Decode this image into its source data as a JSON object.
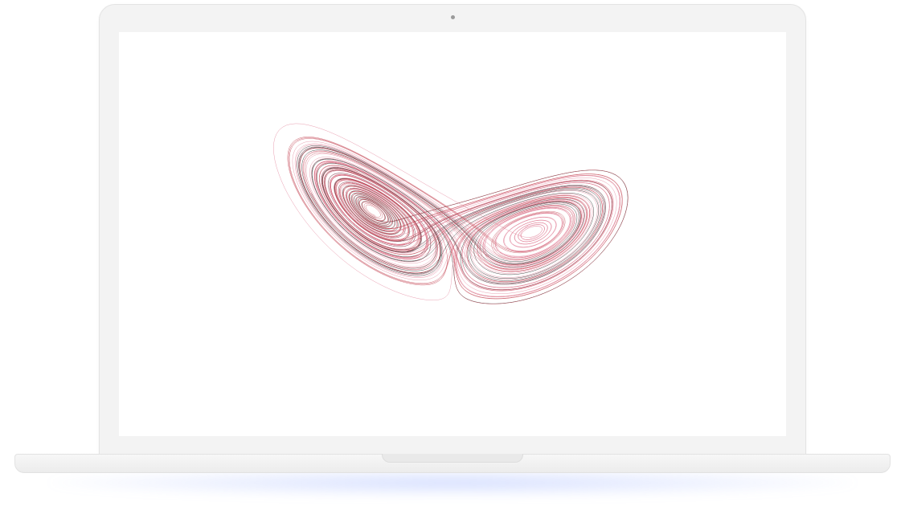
{
  "colors": {
    "trajectory_dark": "#3a3a3a",
    "trajectory_red": "#c03a4a",
    "trajectory_pink": "#e07d95",
    "device_body": "#f3f3f3",
    "screen_background": "#ffffff",
    "shadow_glow": "#8aa2ff"
  },
  "device": {
    "type": "laptop",
    "screen_content": "lorenz-attractor-trajectories"
  }
}
